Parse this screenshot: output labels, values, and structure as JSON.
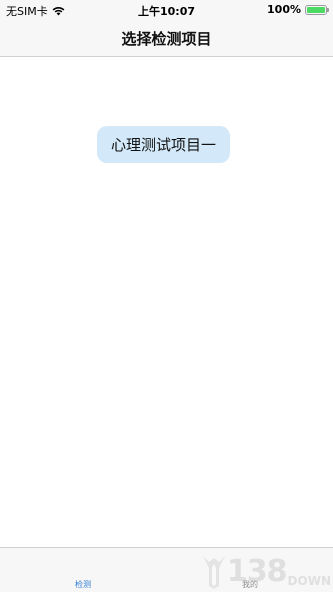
{
  "status_bar": {
    "carrier": "无SIM卡",
    "time": "上午10:07",
    "battery_percent": "100%",
    "battery_level": 1.0,
    "wifi_icon": "wifi-icon",
    "battery_icon": "battery-icon",
    "battery_color": "#4cd964"
  },
  "nav": {
    "title": "选择检测项目"
  },
  "content": {
    "project_button_label": "心理测试项目一",
    "button_color": "#d3e8f8"
  },
  "tab_bar": {
    "tabs": [
      {
        "label": "检测",
        "active": true
      },
      {
        "label": "我的",
        "active": false
      }
    ],
    "active_color": "#2a7bd4"
  },
  "watermark": {
    "number": "138",
    "text": "DOWN"
  }
}
